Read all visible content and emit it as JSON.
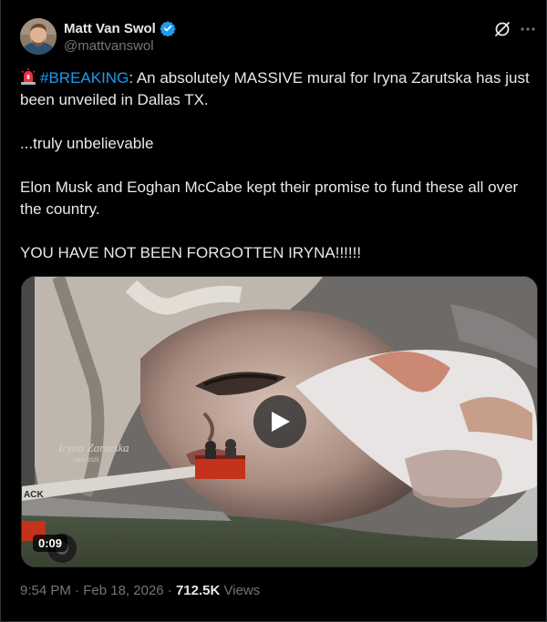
{
  "author": {
    "display_name": "Matt Van Swol",
    "handle": "@mattvanswol",
    "verified_icon": "verified-badge-icon",
    "verified_color": "#1d9bf0"
  },
  "header_actions": {
    "grok_icon": "grok-icon",
    "more_icon": "more-horizontal-icon"
  },
  "tweet": {
    "siren_icon": "police-light-emoji",
    "hashtag": "#BREAKING",
    "line1_rest": ": An absolutely MASSIVE mural for Iryna Zarutska has just been unveiled in Dallas TX.",
    "line2": "...truly unbelievable",
    "line3": "Elon Musk and Eoghan McCabe kept their promise to fund these all over the country.",
    "line4": "YOU HAVE NOT BEEN FORGOTTEN IRYNA!!!!!!"
  },
  "media": {
    "duration": "0:09",
    "play_icon": "play-icon",
    "mural_signature": "Iryna Zarutska",
    "mural_years": "2002-2025",
    "lift_text": "ACK"
  },
  "meta": {
    "time": "9:54 PM",
    "separator": "·",
    "date": "Feb 18, 2026",
    "views_count": "712.5K",
    "views_label": "Views"
  },
  "colors": {
    "background": "#000000",
    "text": "#e7e9ea",
    "secondary": "#71767b",
    "accent": "#1d9bf0",
    "border": "#2f3336"
  }
}
